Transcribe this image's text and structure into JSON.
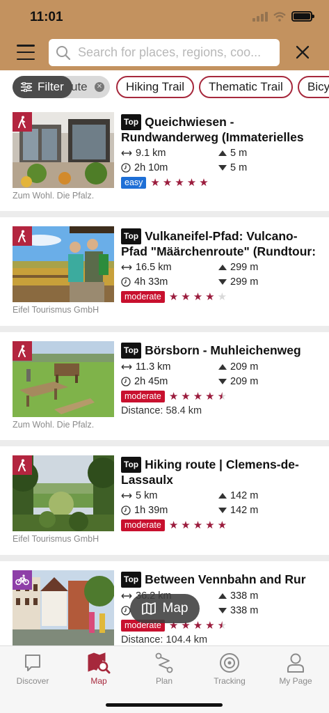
{
  "status_bar": {
    "time": "11:01"
  },
  "header": {
    "search_placeholder": "Search for places, regions, coo...",
    "menu_icon": "hamburger-icon",
    "close_icon": "close-icon"
  },
  "filters": {
    "filter_label": "Filter",
    "active_chip_label": "ute",
    "chips": [
      "Hiking Trail",
      "Thematic Trail",
      "Bicy"
    ]
  },
  "colors": {
    "header_bg": "#c3925f",
    "accent": "#a6283c",
    "easy": "#1e6fd6",
    "moderate": "#c8102e"
  },
  "routes": [
    {
      "activity": "hiking",
      "title_line1": "Queichwiesen -",
      "title_line2": "Rundwanderweg (Immaterielles",
      "top_label": "Top",
      "length": "9.1 km",
      "ascent": "5 m",
      "duration": "2h 10m",
      "descent": "5 m",
      "difficulty": "easy",
      "rating": 5,
      "distance": "",
      "credit": "Zum Wohl. Die Pfalz."
    },
    {
      "activity": "hiking",
      "title_line1": "Vulkaneifel-Pfad: Vulcano-",
      "title_line2": "Pfad \"Määrchenroute\" (Rundtour:",
      "top_label": "Top",
      "length": "16.5 km",
      "ascent": "299 m",
      "duration": "4h 33m",
      "descent": "299 m",
      "difficulty": "moderate",
      "rating": 4,
      "distance": "",
      "credit": "Eifel Tourismus GmbH"
    },
    {
      "activity": "hiking",
      "title_line1": "Börsborn - Muhleichenweg",
      "title_line2": "",
      "top_label": "Top",
      "length": "11.3 km",
      "ascent": "209 m",
      "duration": "2h 45m",
      "descent": "209 m",
      "difficulty": "moderate",
      "rating": 4.5,
      "distance": "Distance: 58.4 km",
      "credit": "Zum Wohl. Die Pfalz."
    },
    {
      "activity": "hiking",
      "title_line1": "Hiking route | Clemens-de-",
      "title_line2": "Lassaulx",
      "top_label": "Top",
      "length": "5 km",
      "ascent": "142 m",
      "duration": "1h 39m",
      "descent": "142 m",
      "difficulty": "moderate",
      "rating": 5,
      "distance": "",
      "credit": "Eifel Tourismus GmbH"
    },
    {
      "activity": "cycling",
      "title_line1": "Between Vennbahn and Rur",
      "title_line2": "",
      "top_label": "Top",
      "length": "36.2 km",
      "ascent": "338 m",
      "duration": "",
      "descent": "338 m",
      "difficulty": "moderate",
      "rating": 4.5,
      "distance": "Distance: 104.4 km",
      "credit": ""
    }
  ],
  "map_button": {
    "label": "Map"
  },
  "tabbar": {
    "tabs": [
      {
        "label": "Discover",
        "icon": "speech-bubble-icon",
        "active": false
      },
      {
        "label": "Map",
        "icon": "map-search-icon",
        "active": true
      },
      {
        "label": "Plan",
        "icon": "route-plan-icon",
        "active": false
      },
      {
        "label": "Tracking",
        "icon": "target-icon",
        "active": false
      },
      {
        "label": "My Page",
        "icon": "user-icon",
        "active": false
      }
    ]
  }
}
